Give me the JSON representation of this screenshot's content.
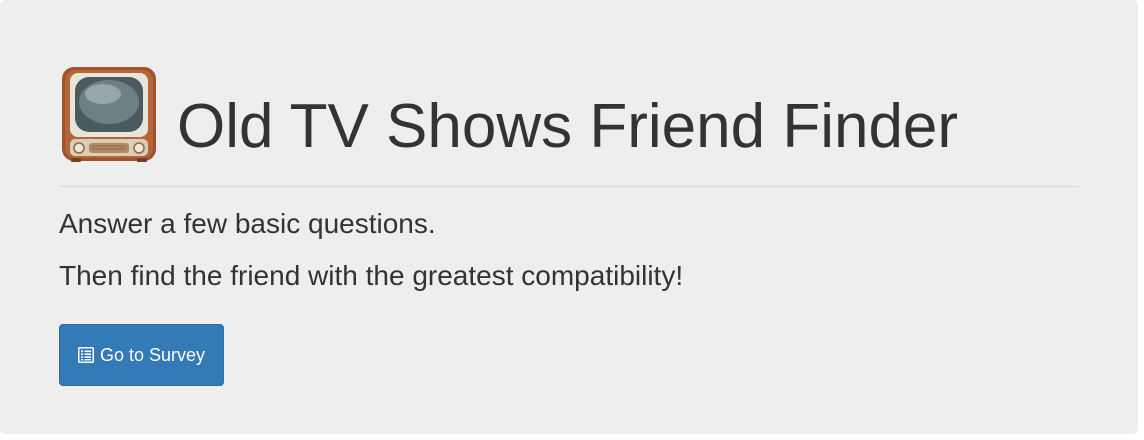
{
  "header": {
    "title": "Old TV Shows Friend Finder",
    "icon": "television-icon"
  },
  "intro": {
    "line1": "Answer a few basic questions.",
    "line2": "Then find the friend with the greatest compatibility!"
  },
  "actions": {
    "survey_button_label": "Go to Survey",
    "survey_button_icon": "list-alt-icon"
  },
  "colors": {
    "background": "#eeeeee",
    "text": "#333333",
    "primary": "#337ab7"
  }
}
